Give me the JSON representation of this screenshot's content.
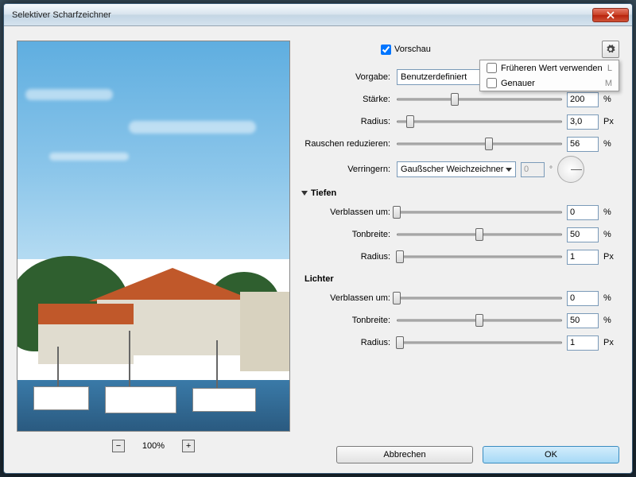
{
  "window": {
    "title": "Selektiver Scharfzeichner"
  },
  "preview": {
    "checkbox_label": "Vorschau"
  },
  "gear_menu": {
    "item1": {
      "label": "Früheren Wert verwenden",
      "key": "L"
    },
    "item2": {
      "label": "Genauer",
      "key": "M"
    }
  },
  "preset": {
    "label": "Vorgabe:",
    "value": "Benutzerdefiniert"
  },
  "sharpen": {
    "strength": {
      "label": "Stärke:",
      "value": "200",
      "unit": "%",
      "pos": 35
    },
    "radius": {
      "label": "Radius:",
      "value": "3,0",
      "unit": "Px",
      "pos": 8
    },
    "noise": {
      "label": "Rauschen reduzieren:",
      "value": "56",
      "unit": "%",
      "pos": 56
    }
  },
  "reduce": {
    "label": "Verringern:",
    "method": "Gaußscher Weichzeichner",
    "angle": "0"
  },
  "section_shadows": "Tiefen",
  "shadows": {
    "fade": {
      "label": "Verblassen um:",
      "value": "0",
      "unit": "%",
      "pos": 0
    },
    "tone": {
      "label": "Tonbreite:",
      "value": "50",
      "unit": "%",
      "pos": 50
    },
    "radius": {
      "label": "Radius:",
      "value": "1",
      "unit": "Px",
      "pos": 2
    }
  },
  "section_highlights": "Lichter",
  "highlights": {
    "fade": {
      "label": "Verblassen um:",
      "value": "0",
      "unit": "%",
      "pos": 0
    },
    "tone": {
      "label": "Tonbreite:",
      "value": "50",
      "unit": "%",
      "pos": 50
    },
    "radius": {
      "label": "Radius:",
      "value": "1",
      "unit": "Px",
      "pos": 2
    }
  },
  "zoom": {
    "percent": "100%"
  },
  "buttons": {
    "cancel": "Abbrechen",
    "ok": "OK"
  }
}
